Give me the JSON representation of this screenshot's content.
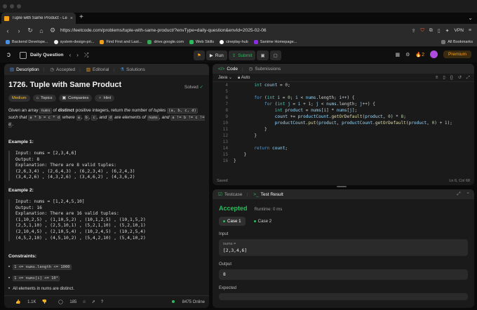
{
  "browser": {
    "tab_title": "Tuple with Same Product - Le",
    "url": "https://leetcode.com/problems/tuple-with-same-product/?envType=daily-question&envId=2025-02-06",
    "vpn_label": "VPN",
    "bookmarks": [
      "Backend Develope...",
      "system-design-pri...",
      "Find First and Last...",
      "drive.google.com",
      "Web Skills",
      "cineplay-hub",
      "Sanime Homepage..."
    ],
    "all_bookmarks": "All Bookmarks"
  },
  "leetcode_bar": {
    "daily_question": "Daily Question",
    "run": "Run",
    "submit": "Submit",
    "streak": "2",
    "premium": "Premium"
  },
  "left_panel": {
    "tabs": [
      "Description",
      "Accepted",
      "Editorial",
      "Solutions"
    ],
    "title": "1726. Tuple with Same Product",
    "solved": "Solved",
    "tags": [
      "Medium",
      "Topics",
      "Companies",
      "Hint"
    ],
    "desc_parts": {
      "p1": "Given an array ",
      "nums": "nums",
      "p2": " of ",
      "distinct": "distinct",
      "p3": " positive integers, return ",
      "p4": "the number of tuples ",
      "tuple": "(a, b, c, d)",
      "p5": " such that ",
      "eq": "a * b = c * d",
      "p6": " where ",
      "a": "a",
      "b": "b",
      "c": "c",
      "and": ", and ",
      "d": "d",
      "p7": " are elements of ",
      "nums2": "nums",
      "p8": ", and ",
      "neq": "a != b != c != d",
      "p9": "."
    },
    "example1_title": "Example 1:",
    "example1": "Input: nums = [2,3,4,6]\nOutput: 8\nExplanation: There are 8 valid tuples:\n(2,6,3,4) , (2,6,4,3) , (6,2,3,4) , (6,2,4,3)\n(3,4,2,6) , (4,3,2,6) , (3,4,6,2) , (4,3,6,2)",
    "example2_title": "Example 2:",
    "example2": "Input: nums = [1,2,4,5,10]\nOutput: 16\nExplanation: There are 16 valid tuples:\n(1,10,2,5) , (1,10,5,2) , (10,1,2,5) , (10,1,5,2)\n(2,5,1,10) , (2,5,10,1) , (5,2,1,10) , (5,2,10,1)\n(2,10,4,5) , (2,10,5,4) , (10,2,4,5) , (10,2,5,4)\n(4,5,2,10) , (4,5,10,2) , (5,4,2,10) , (5,4,10,2)",
    "constraints_title": "Constraints:",
    "constraints": [
      "1 <= nums.length <= 1000",
      "1 <= nums[i] <= 10⁴",
      "All elements in nums are distinct."
    ],
    "footer": {
      "likes": "1.1K",
      "comments": "185",
      "online": "8475 Online"
    }
  },
  "code_panel": {
    "tabs": [
      "Code",
      "Submissions"
    ],
    "language": "Java",
    "auto": "Auto",
    "status_left": "Saved",
    "status_right": "Ln 6, Col 68"
  },
  "test_panel": {
    "tabs": [
      "Testcase",
      "Test Result"
    ],
    "result": "Accepted",
    "runtime": "Runtime: 0 ms",
    "cases": [
      "Case 1",
      "Case 2"
    ],
    "input_label": "Input",
    "input_name": "nums =",
    "input_value": "[2,3,4,6]",
    "output_label": "Output",
    "output_value": "8",
    "expected_label": "Expected"
  },
  "colors": {
    "accent_green": "#2cbb5d",
    "medium": "#ffc01e",
    "premium": "#f7a21b"
  }
}
